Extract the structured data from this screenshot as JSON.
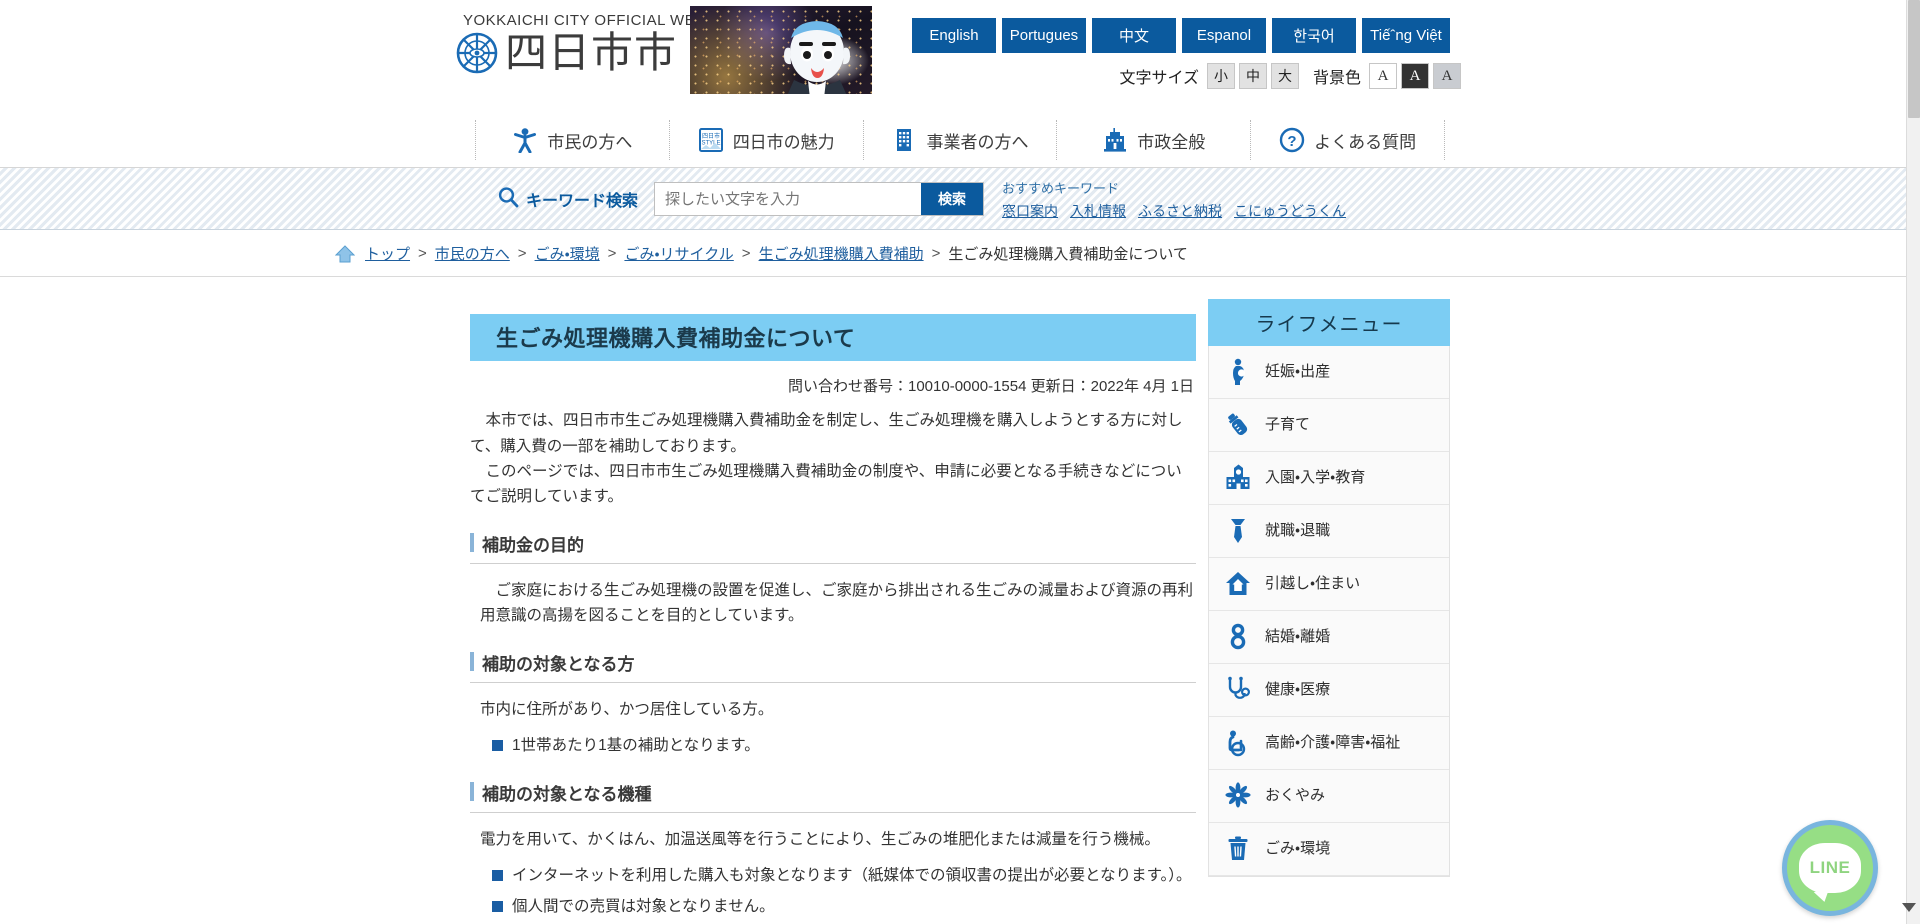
{
  "header": {
    "brand_supertitle": "YOKKAICHI CITY OFFICIAL WEBSITE",
    "brand_name": "四日市市",
    "languages": [
      {
        "label": "English"
      },
      {
        "label": "Portugues"
      },
      {
        "label": "中文"
      },
      {
        "label": "Espanol"
      },
      {
        "label": "한국어"
      },
      {
        "label": "Tiếˆng Việt"
      }
    ],
    "text_size_label": "文字サイズ",
    "text_sizes": [
      {
        "label": "小"
      },
      {
        "label": "中"
      },
      {
        "label": "大"
      }
    ],
    "bg_color_label": "背景色",
    "bg_colors": [
      {
        "label": "A"
      },
      {
        "label": "A"
      },
      {
        "label": "A"
      }
    ]
  },
  "gnav": [
    {
      "label": "市民の方へ",
      "icon": "person-icon"
    },
    {
      "label": "四日市の魅力",
      "icon": "style-badge-icon"
    },
    {
      "label": "事業者の方へ",
      "icon": "office-building-icon"
    },
    {
      "label": "市政全般",
      "icon": "city-hall-icon"
    },
    {
      "label": "よくある質問",
      "icon": "question-mark-icon"
    }
  ],
  "search": {
    "keyword_label": "キーワード検索",
    "placeholder": "探したい文字を入力",
    "value": "",
    "button_label": "検索",
    "suggest_title": "おすすめキーワード",
    "suggest_links": [
      {
        "label": "窓口案内"
      },
      {
        "label": "入札情報"
      },
      {
        "label": "ふるさと納税"
      },
      {
        "label": "こにゅうどうくん"
      }
    ]
  },
  "breadcrumb": {
    "items": [
      {
        "label": "トップ",
        "link": true
      },
      {
        "label": "市民の方へ",
        "link": true
      },
      {
        "label": "ごみ・環境",
        "link": true
      },
      {
        "label": "ごみ・リサイクル",
        "link": true
      },
      {
        "label": "生ごみ処理機購入費補助",
        "link": true
      },
      {
        "label": "生ごみ処理機購入費補助金について",
        "link": false
      }
    ],
    "separator": ">"
  },
  "main": {
    "page_title": "生ごみ処理機購入費補助金について",
    "meta": "問い合わせ番号：10010-0000-1554 更新日：2022年 4月 1日",
    "intro": [
      "本市では、四日市市生ごみ処理機購入費補助金を制定し、生ごみ処理機を購入しようとする方に対して、購入費の一部を補助しております。",
      "このページでは、四日市市生ごみ処理機購入費補助金の制度や、申請に必要となる手続きなどについてご説明しています。"
    ],
    "sections": [
      {
        "heading": "補助金の目的",
        "paragraphs": [
          "ご家庭における生ごみ処理機の設置を促進し、ご家庭から排出される生ごみの減量および資源の再利用意識の高揚を図ることを目的としています。"
        ],
        "bullets": []
      },
      {
        "heading": "補助の対象となる方",
        "paragraphs": [
          "市内に住所があり、かつ居住している方。"
        ],
        "bullets": [
          "1世帯あたり1基の補助となります。"
        ]
      },
      {
        "heading": "補助の対象となる機種",
        "paragraphs": [
          "電力を用いて、かくはん、加温送風等を行うことにより、生ごみの堆肥化または減量を行う機械。"
        ],
        "bullets": [
          "インターネットを利用した購入も対象となります（紙媒体での領収書の提出が必要となります。）。",
          "個人間での売買は対象となりません。"
        ]
      }
    ]
  },
  "sidebar": {
    "title": "ライフメニュー",
    "items": [
      {
        "label": "妊娠・出産",
        "icon": "pregnancy-icon"
      },
      {
        "label": "子育て",
        "icon": "baby-bottle-icon"
      },
      {
        "label": "入園・入学・教育",
        "icon": "school-icon"
      },
      {
        "label": "就職・退職",
        "icon": "necktie-icon"
      },
      {
        "label": "引越し・住まい",
        "icon": "house-icon"
      },
      {
        "label": "結婚・離婚",
        "icon": "rings-icon"
      },
      {
        "label": "健康・医療",
        "icon": "stethoscope-icon"
      },
      {
        "label": "高齢・介護・障害・福祉",
        "icon": "wheelchair-icon"
      },
      {
        "label": "おくやみ",
        "icon": "flower-icon"
      },
      {
        "label": "ごみ・環境",
        "icon": "trash-bin-icon"
      }
    ]
  },
  "floating": {
    "line_label": "LINE"
  },
  "colors": {
    "brand_blue": "#0b5a9e",
    "title_band": "#7ccdf3",
    "icon_blue": "#1a6bb5",
    "link_blue": "#1f5f9e",
    "line_green": "#96de85"
  }
}
